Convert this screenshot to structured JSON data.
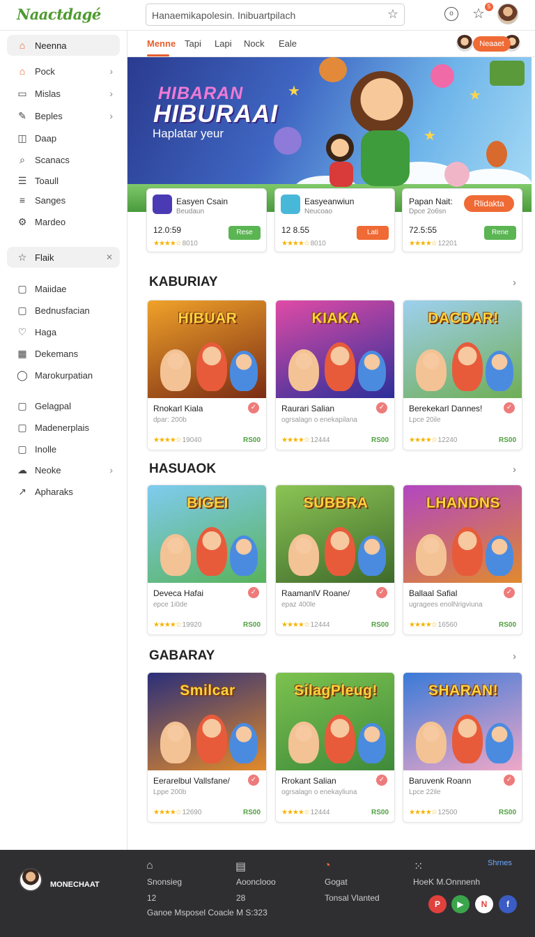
{
  "app": {
    "logo": "Naactdagé",
    "search_value": "Hanaemikapolesin. Inibuartpilach",
    "notification_count": "5",
    "help_icon": "o"
  },
  "sidebar": {
    "items": [
      {
        "label": "Neenna",
        "icon": "home-icon",
        "active": true
      },
      {
        "label": "Pock",
        "icon": "home-icon",
        "chevron": true
      },
      {
        "label": "Mislas",
        "icon": "folder-icon",
        "chevron": true
      },
      {
        "label": "Beples",
        "icon": "pencil-icon",
        "chevron": true
      },
      {
        "label": "Daap",
        "icon": "bag-icon"
      },
      {
        "label": "Scanacs",
        "icon": "search-icon"
      },
      {
        "label": "Toaull",
        "icon": "group-icon"
      },
      {
        "label": "Sanges",
        "icon": "list-icon"
      },
      {
        "label": "Mardeo",
        "icon": "gear-icon"
      },
      {
        "label": "Flaik",
        "icon": "star-icon",
        "active": true,
        "close": true
      },
      {
        "label": "Maiidae",
        "icon": "file-icon"
      },
      {
        "label": "Bednusfacian",
        "icon": "file-icon"
      },
      {
        "label": "Haga",
        "icon": "heart-icon"
      },
      {
        "label": "Dekemans",
        "icon": "grid-icon"
      },
      {
        "label": "Marokurpatian",
        "icon": "circle-icon"
      },
      {
        "label": "Gelagpal",
        "icon": "file-icon"
      },
      {
        "label": "Madenerplais",
        "icon": "file-icon"
      },
      {
        "label": "Inolle",
        "icon": "file-icon"
      },
      {
        "label": "Neoke",
        "icon": "cloud-icon",
        "chevron": true
      },
      {
        "label": "Apharaks",
        "icon": "arrow-icon"
      }
    ]
  },
  "tabs": {
    "items": [
      "Menne",
      "Tapi",
      "Lapi",
      "Nock",
      "Eale"
    ],
    "button": "Neaaet"
  },
  "hero": {
    "title_top": "HIBARAN",
    "title_main": "HIBURAAI",
    "subtitle": "Haplatar yeur"
  },
  "featured": [
    {
      "title": "Easyen Csain",
      "sub": "Beudaun",
      "price": "12.0:59",
      "rating": "8010",
      "button": "Rese",
      "btn_color": "#5ab552",
      "icon_color": "#4a3bb5"
    },
    {
      "title": "Easyeanwiun",
      "sub": "Neucoao",
      "price": "12 8.55",
      "rating": "8010",
      "button": "Lati",
      "btn_color": "#ef6a34",
      "icon_color": "#48b8d8"
    },
    {
      "title": "Papan Nait:",
      "sub": "Dpce 2o6sn",
      "price": "72.5:55",
      "rating": "12201",
      "button": "Rene",
      "btn_color": "#5ab552",
      "badge": "Rlidakta"
    }
  ],
  "sections": [
    {
      "title": "KABURIAY",
      "games": [
        {
          "title": "Rnokarl Kiala",
          "sub": "dpar: 200b",
          "rating": "19040",
          "price": "RS00",
          "thumb_text": "HIBUAR",
          "bg1": "#f0a22a",
          "bg2": "#7a2b14"
        },
        {
          "title": "Raurari Salian",
          "sub": "ogrsalagn o enekapilana",
          "rating": "12444",
          "price": "RS00",
          "thumb_text": "KIAKA",
          "bg1": "#e04ba6",
          "bg2": "#2b2f9a"
        },
        {
          "title": "Berekekarl Dannes!",
          "sub": "Lpce 20ile",
          "rating": "12240",
          "price": "RS00",
          "thumb_text": "DACDAR!",
          "bg1": "#9ed0ef",
          "bg2": "#6fae55"
        }
      ]
    },
    {
      "title": "HASUAOK",
      "games": [
        {
          "title": "Deveca Hafai",
          "sub": "epce 1i0de",
          "rating": "19920",
          "price": "RS00",
          "thumb_text": "BIGEI",
          "bg1": "#7fcbf0",
          "bg2": "#58b35a"
        },
        {
          "title": "RaamanlV Roane/",
          "sub": "epaz 400le",
          "rating": "12444",
          "price": "RS00",
          "thumb_text": "SUBBRA",
          "bg1": "#8cc455",
          "bg2": "#3e6a2a"
        },
        {
          "title": "Ballaal Safial",
          "sub": "ugragees enolNrigviuna",
          "rating": "16560",
          "price": "RS00",
          "thumb_text": "LHANDNS",
          "bg1": "#b246c2",
          "bg2": "#e08a2e"
        }
      ]
    },
    {
      "title": "GABARAY",
      "games": [
        {
          "title": "Eerarelbul Vallsfane/",
          "sub": "Lppe 200b",
          "rating": "12690",
          "price": "RS00",
          "thumb_text": "Smilcar",
          "bg1": "#2a2f7a",
          "bg2": "#e28a2a"
        },
        {
          "title": "Rrokant Salian",
          "sub": "ogrsalagn o enekayliuna",
          "rating": "12444",
          "price": "RS00",
          "thumb_text": "SilagPleug!",
          "bg1": "#7cc24f",
          "bg2": "#3e8a3a"
        },
        {
          "title": "Baruvenk Roann",
          "sub": "Lpce 22ile",
          "rating": "12500",
          "price": "RS00",
          "thumb_text": "SHARAN!",
          "bg1": "#3a7ad8",
          "bg2": "#f0a8c8"
        }
      ]
    }
  ],
  "footer": {
    "name": "MONECHAAT",
    "col1_label": "Snonsieg",
    "col1_value": "12",
    "col2_label": "Aoonclooo",
    "col2_value": "28",
    "col3_label": "Gogat",
    "col3_value": "Tonsal Vlanted",
    "col4_label": "HoeK M.Onnnenh",
    "bottom_text": "Ganoe Msposel Coacle M S:323",
    "link": "Shrnes",
    "socials": [
      {
        "name": "pinterest-icon",
        "glyph": "P",
        "color": "#e0413c"
      },
      {
        "name": "play-icon",
        "glyph": "▶",
        "color": "#3aa54a"
      },
      {
        "name": "n-icon",
        "glyph": "N",
        "color": "#ffffff"
      },
      {
        "name": "facebook-icon",
        "glyph": "f",
        "color": "#3b5cc4"
      }
    ]
  }
}
